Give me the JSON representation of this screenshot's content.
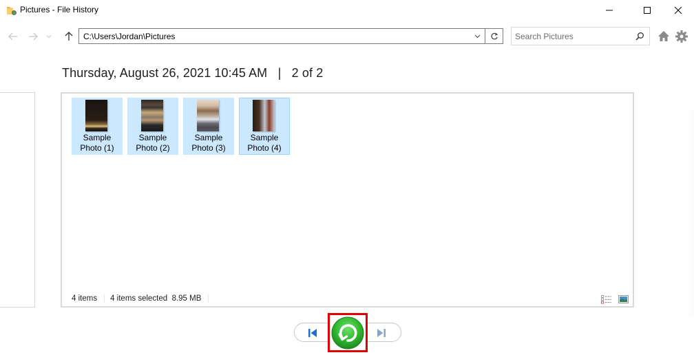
{
  "window": {
    "title": "Pictures - File History",
    "icon": "folder-history-icon",
    "controls": [
      "minimize",
      "maximize",
      "close"
    ]
  },
  "navigation": {
    "back_icon": "arrow-left-icon",
    "forward_icon": "arrow-right-icon",
    "recent_icon": "chevron-down-icon",
    "up_icon": "arrow-up-icon",
    "address": "C:\\Users\\Jordan\\Pictures",
    "search_placeholder": "Search Pictures",
    "search_value": ""
  },
  "header": {
    "date": "Thursday, August 26, 2021 10:45 AM",
    "separator": "|",
    "position": "2 of 2"
  },
  "files": [
    {
      "name": "Sample Photo (1)",
      "line1": "Sample",
      "line2": "Photo (1)",
      "selected": true
    },
    {
      "name": "Sample Photo (2)",
      "line1": "Sample",
      "line2": "Photo (2)",
      "selected": true
    },
    {
      "name": "Sample Photo (3)",
      "line1": "Sample",
      "line2": "Photo (3)",
      "selected": true
    },
    {
      "name": "Sample Photo (4)",
      "line1": "Sample",
      "line2": "Photo (4)",
      "selected": true,
      "focused": true
    }
  ],
  "status": {
    "item_count": "4 items",
    "selection": "4 items selected  8.95 MB"
  },
  "view_modes": [
    "details-view",
    "large-icons-view"
  ],
  "playback": {
    "previous_label": "Previous version",
    "restore_label": "Restore to original location",
    "next_label": "Next version",
    "highlight_color": "#e00000",
    "restore_color": "#2fb62f"
  }
}
